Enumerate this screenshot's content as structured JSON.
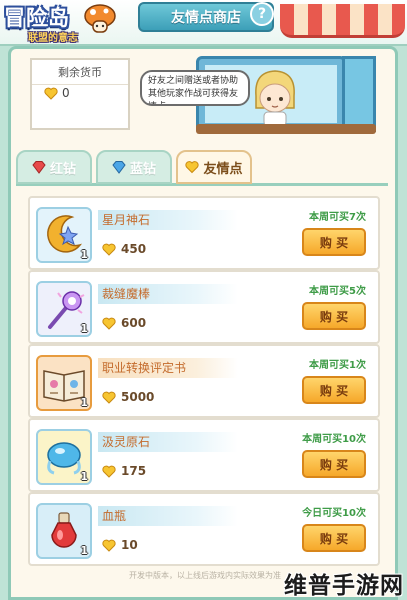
{
  "header": {
    "logo_title": "冒险岛",
    "logo_subtitle": "联盟的意志",
    "shop_title": "友情点商店",
    "help_label": "?"
  },
  "currency": {
    "label": "剩余货币",
    "amount": "0",
    "icon": "heart-icon"
  },
  "npc": {
    "speech": "好友之间赠送或者协助其他玩家作战可获得友情点"
  },
  "tabs": [
    {
      "label": "红钻",
      "icon": "red-diamond-icon",
      "active": false
    },
    {
      "label": "蓝钻",
      "icon": "blue-diamond-icon",
      "active": false
    },
    {
      "label": "友情点",
      "icon": "heart-icon",
      "active": true
    }
  ],
  "items": [
    {
      "name": "星月神石",
      "price": "450",
      "limit": "本周可买7次",
      "count": "1",
      "buy_label": "购 买",
      "icon": "star-moon-stone-icon"
    },
    {
      "name": "裁缝魔棒",
      "price": "600",
      "limit": "本周可买5次",
      "count": "1",
      "buy_label": "购 买",
      "icon": "magic-wand-icon"
    },
    {
      "name": "职业转换评定书",
      "price": "5000",
      "limit": "本周可买1次",
      "count": "1",
      "buy_label": "购 买",
      "icon": "job-change-book-icon"
    },
    {
      "name": "汲灵原石",
      "price": "175",
      "limit": "本周可买10次",
      "count": "1",
      "buy_label": "购 买",
      "icon": "spirit-ore-icon"
    },
    {
      "name": "血瓶",
      "price": "10",
      "limit": "今日可买10次",
      "count": "1",
      "buy_label": "购 买",
      "icon": "red-potion-icon"
    }
  ],
  "footer": {
    "note": "开发中版本，以上线后游戏内实际效果为准",
    "watermark": "维普手游网"
  },
  "colors": {
    "accent": "#f6a82a",
    "limit_text": "#3f9c48",
    "item_name": "#c46b2c",
    "frame": "#8fc9b7"
  }
}
